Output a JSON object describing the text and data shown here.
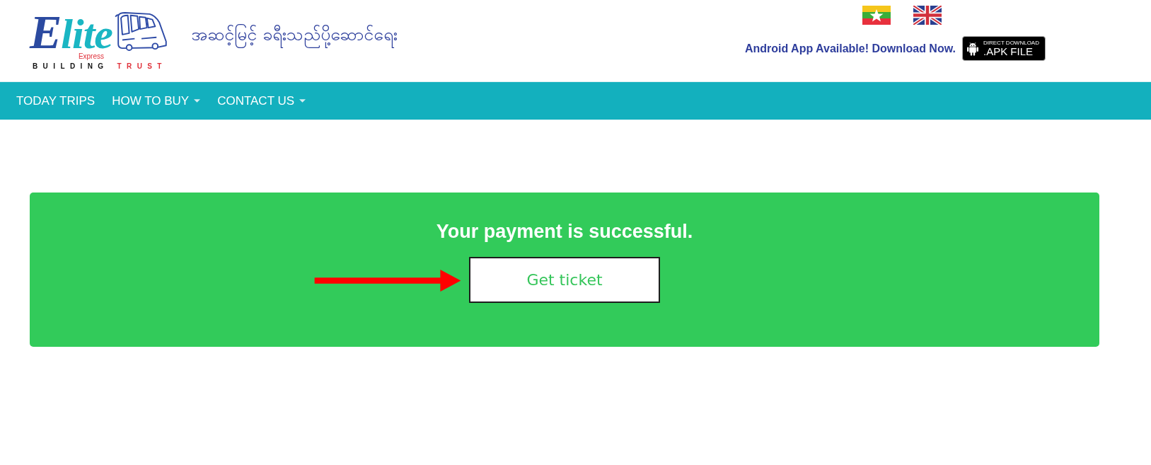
{
  "header": {
    "logo": {
      "wordmark": "Elite",
      "subtitle": "Express",
      "slogan": [
        "BUILDING",
        "TRUST"
      ]
    },
    "tagline": "အဆင့်မြင့် ခရီးသည်ပို့ဆောင်ရေး",
    "app_notice": "Android App Available! Download Now.",
    "apk_badge": {
      "caption": "DIRECT DOWNLOAD",
      "label": ".APK FILE"
    }
  },
  "nav": {
    "items": [
      {
        "label": "TODAY TRIPS",
        "kind": "link"
      },
      {
        "label": "HOW TO BUY",
        "kind": "dropdown"
      },
      {
        "label": "CONTACT US",
        "kind": "dropdown"
      }
    ]
  },
  "payment": {
    "message": "Your payment is successful.",
    "button": "Get ticket"
  }
}
